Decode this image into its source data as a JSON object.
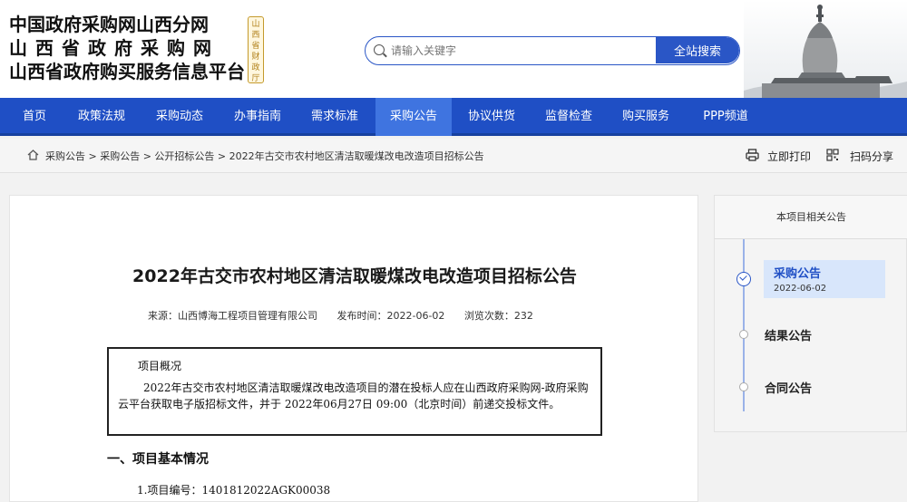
{
  "header": {
    "brand_lines": [
      "中国政府采购网山西分网",
      "山西省政府采购网",
      "山西省政府购买服务信息平台"
    ],
    "seal_text": "山西省财政厅",
    "search": {
      "placeholder": "请输入关键字",
      "button_label": "全站搜索"
    }
  },
  "nav": {
    "items": [
      "首页",
      "政策法规",
      "采购动态",
      "办事指南",
      "需求标准",
      "采购公告",
      "协议供货",
      "监督检查",
      "购买服务",
      "PPP频道"
    ],
    "active_index": 5
  },
  "breadcrumb": {
    "text": "采购公告 > 采购公告 > 公开招标公告 > 2022年古交市农村地区清洁取暖煤改电改造项目招标公告",
    "print_label": "立即打印",
    "share_label": "扫码分享"
  },
  "article": {
    "title": "2022年古交市农村地区清洁取暖煤改电改造项目招标公告",
    "meta": {
      "source": "来源：山西博海工程项目管理有限公司",
      "published": "发布时间：2022-06-02",
      "views": "浏览次数：232"
    },
    "overview_title": "项目概况",
    "overview_body": "2022年古交市农村地区清洁取暖煤改电改造项目的潜在投标人应在山西政府采购网-政府采购云平台获取电子版招标文件，并于 2022年06月27日 09:00（北京时间）前递交投标文件。",
    "section_heading": "一、项目基本情况",
    "project_number": "1.项目编号：1401812022AGK00038"
  },
  "sidebar": {
    "heading": "本项目相关公告",
    "items": [
      {
        "label": "采购公告",
        "date": "2022-06-02"
      },
      {
        "label": "结果公告"
      },
      {
        "label": "合同公告"
      }
    ]
  },
  "colors": {
    "nav_blue": "#1f4fc5",
    "nav_active": "#3f74e0",
    "accent": "#2a56c6"
  }
}
